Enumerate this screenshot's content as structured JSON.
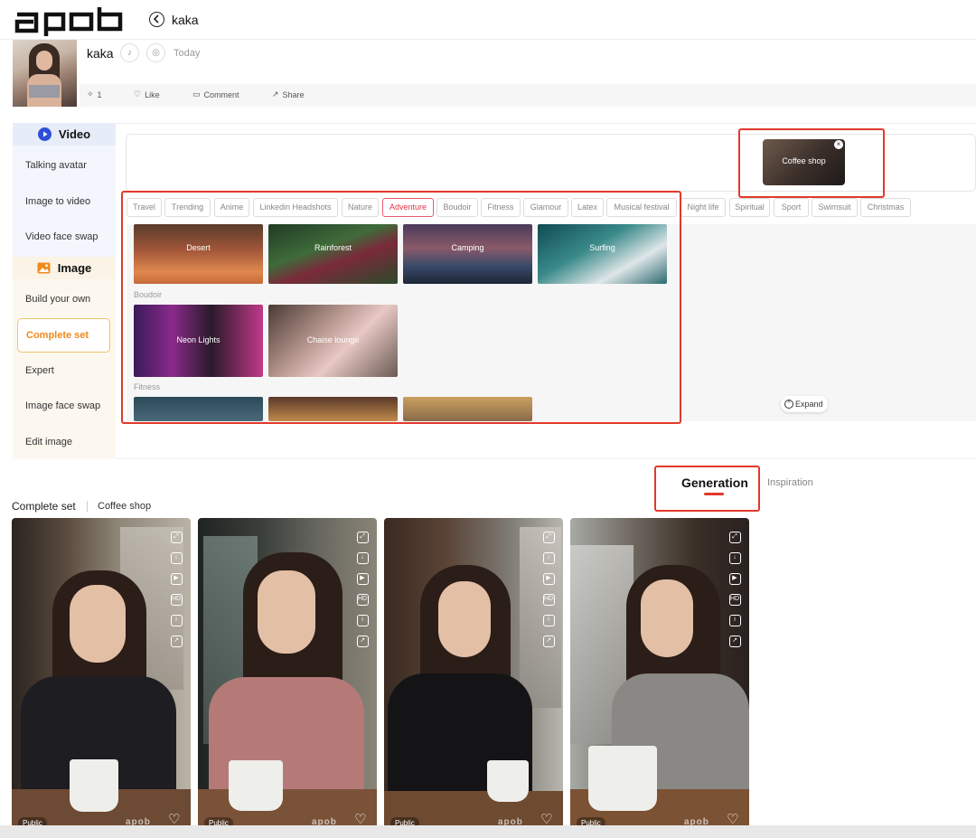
{
  "header": {
    "logo_text": "apob",
    "title": "kaka",
    "icons": {
      "back": "arrow-left-circle-icon"
    }
  },
  "profile": {
    "name": "kaka",
    "date": "Today",
    "socials": [
      "tiktok-icon",
      "instagram-icon"
    ],
    "actions": [
      {
        "icon": "sparkle-icon",
        "label": "1"
      },
      {
        "icon": "heart-icon",
        "label": "Like"
      },
      {
        "icon": "comment-icon",
        "label": "Comment"
      },
      {
        "icon": "share-icon",
        "label": "Share"
      }
    ]
  },
  "sidebar": {
    "video_heading": "Video",
    "video_items": [
      "Talking avatar",
      "Image to video",
      "Video face swap"
    ],
    "image_heading": "Image",
    "image_items": [
      "Build your own",
      "Complete set",
      "Expert",
      "Image face swap",
      "Edit image"
    ],
    "selected": "Complete set"
  },
  "selected_scene": {
    "label": "Coffee shop",
    "close_icon": "close-icon"
  },
  "categories": [
    "Travel",
    "Trending",
    "Anime",
    "Linkedin Headshots",
    "Nature",
    "Adventure",
    "Boudoir",
    "Fitness",
    "Glamour",
    "Latex",
    "Musical festival",
    "Night life",
    "Spiritual",
    "Sport",
    "Swimsuit",
    "Christmas"
  ],
  "active_category": "Adventure",
  "gallery": {
    "adventure_tiles": [
      "Desert",
      "Rainforest",
      "Camping",
      "Surfing"
    ],
    "boudoir_label": "Boudoir",
    "boudoir_tiles": [
      "Neon Lights",
      "Chaise lounge"
    ],
    "fitness_label": "Fitness"
  },
  "expand_label": "Expand",
  "tabs": {
    "generation": "Generation",
    "inspiration": "Inspiration"
  },
  "breadcrumb": {
    "mode": "Complete set",
    "scene": "Coffee shop"
  },
  "results": {
    "badge": "Public",
    "watermark": "apob",
    "card_icons": [
      "crop-icon",
      "download-icon",
      "video-icon",
      "hd-icon",
      "info-icon",
      "share-icon"
    ]
  },
  "colors": {
    "accent": "#e2392b",
    "selected_menu": "#f08a1c",
    "active_tag": "#e0334a",
    "video_icon": "#2f4fd8"
  }
}
